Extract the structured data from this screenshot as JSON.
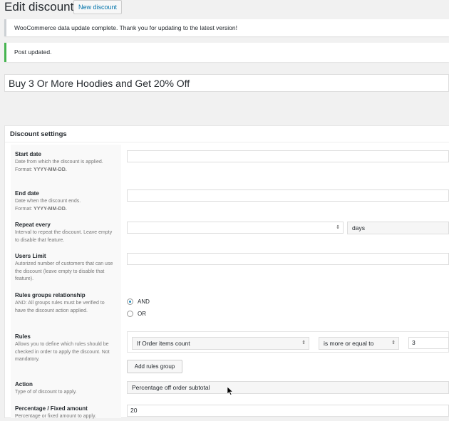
{
  "header": {
    "title": "Edit discount",
    "new_button": "New discount"
  },
  "notices": {
    "update": "WooCommerce data update complete. Thank you for updating to the latest version!",
    "post": "Post updated."
  },
  "post_title": "Buy 3 Or More Hoodies and Get 20% Off",
  "settings": {
    "title": "Discount settings",
    "start_date": {
      "label": "Start date",
      "desc": "Date from which the discount is applied.",
      "format_prefix": "Format: ",
      "format": "YYYY-MM-DD.",
      "value": ""
    },
    "end_date": {
      "label": "End date",
      "desc": "Date when the discount ends.",
      "format_prefix": "Format: ",
      "format": "YYYY-MM-DD.",
      "value": ""
    },
    "repeat_every": {
      "label": "Repeat every",
      "desc": "Interval to repeat the discount. Leave empty to disable that feature.",
      "value": "",
      "unit": "days"
    },
    "users_limit": {
      "label": "Users Limit",
      "desc": "Autorized number of customers that can use the discount (leave empty to disable that feature).",
      "value": ""
    },
    "rules_rel": {
      "label": "Rules groups relationship",
      "desc": "AND: All groups rules must be verified to have the discount action applied.",
      "options": [
        "AND",
        "OR"
      ],
      "selected": "AND"
    },
    "rules": {
      "label": "Rules",
      "desc": "Allows you to define which rules should be checked in order to apply the discount. Not mandatory.",
      "condition": "If Order items count",
      "operator": "is more or equal to",
      "value": "3",
      "add_button": "Add rules group"
    },
    "action": {
      "label": "Action",
      "desc": "Type of of discount to apply.",
      "value": "Percentage off order subtotal"
    },
    "amount": {
      "label": "Percentage / Fixed amount",
      "desc": "Percentage or fixed amount to apply.",
      "value": "20"
    }
  },
  "colors": {
    "accent": "#0073aa",
    "success": "#46b450",
    "radio": "#1e8cbe"
  }
}
